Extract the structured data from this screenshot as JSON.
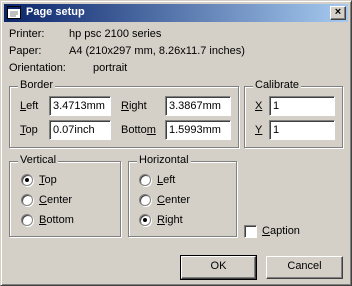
{
  "window": {
    "title": "Page setup",
    "close_label": "×"
  },
  "info": {
    "printer_label": "Printer:",
    "printer_value": "hp psc 2100 series",
    "paper_label": "Paper:",
    "paper_value": "A4 (210x297 mm, 8.26x11.7 inches)",
    "orientation_label": "Orientation:",
    "orientation_value": "portrait"
  },
  "border": {
    "legend": "Border",
    "left_label_u": "L",
    "left_label_rest": "eft",
    "left_value": "3.4713mm",
    "right_label_u": "R",
    "right_label_rest": "ight",
    "right_value": "3.3867mm",
    "top_label_u": "T",
    "top_label_rest": "op",
    "top_value": "0.07inch",
    "bottom_label_pre": "Botto",
    "bottom_label_u": "m",
    "bottom_value": "1.5993mm"
  },
  "calibrate": {
    "legend": "Calibrate",
    "x_label": "X",
    "x_value": "1",
    "y_label": "Y",
    "y_value": "1"
  },
  "vertical": {
    "legend": "Vertical",
    "options": [
      {
        "u": "T",
        "rest": "op",
        "checked": true
      },
      {
        "u": "C",
        "rest": "enter",
        "checked": false
      },
      {
        "u": "B",
        "rest": "ottom",
        "checked": false
      }
    ]
  },
  "horizontal": {
    "legend": "Horizontal",
    "options": [
      {
        "u": "L",
        "rest": "eft",
        "checked": false
      },
      {
        "u": "C",
        "rest": "enter",
        "checked": false
      },
      {
        "u": "R",
        "rest": "ight",
        "checked": true
      }
    ]
  },
  "caption": {
    "u": "C",
    "rest": "aption",
    "checked": false
  },
  "buttons": {
    "ok": "OK",
    "cancel": "Cancel"
  }
}
